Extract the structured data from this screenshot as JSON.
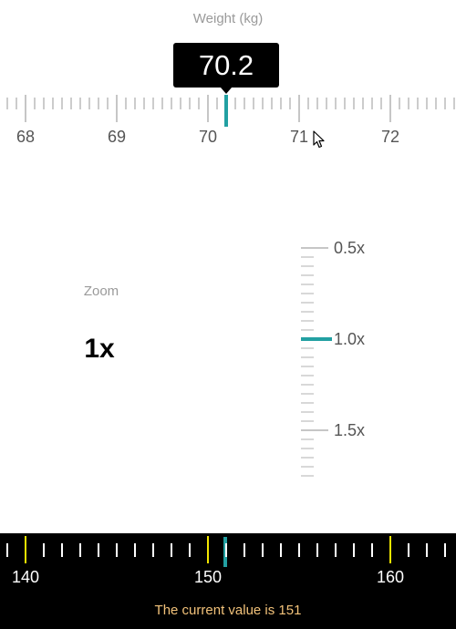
{
  "weight": {
    "title": "Weight (kg)",
    "value": 70.2,
    "value_label": "70.2",
    "scale_min": 67.7,
    "scale_max": 72.7,
    "labels": [
      "68",
      "69",
      "70",
      "71",
      "72"
    ],
    "accent_color": "#22a0a2"
  },
  "zoom": {
    "title": "Zoom",
    "value_label": "1x",
    "selected": 1.0,
    "labels": [
      "0.5x",
      "1.0x",
      "1.5x"
    ],
    "accent_color": "#22a0a2"
  },
  "slider": {
    "value": 151,
    "labels": [
      "140",
      "150",
      "160"
    ],
    "status_text": "The current value is 151",
    "accent_color": "#22a0a2",
    "major_tick_color": "#f2e600",
    "status_color": "#f2c27a"
  }
}
